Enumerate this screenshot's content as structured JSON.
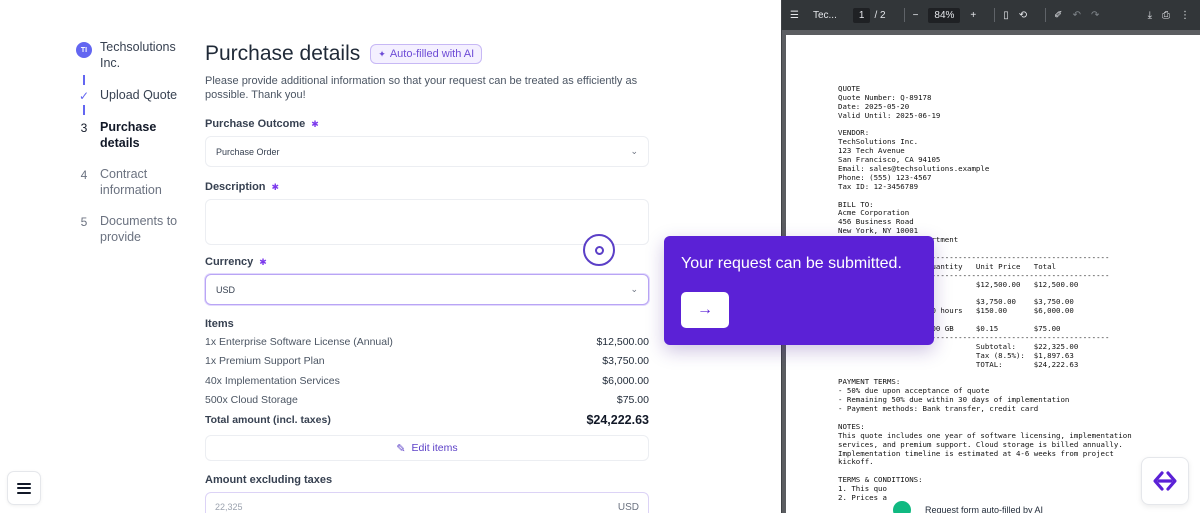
{
  "stepper": {
    "steps": [
      {
        "marker": "TI",
        "label": "Techsolutions Inc."
      },
      {
        "marker": "✓",
        "label": "Upload Quote"
      },
      {
        "marker": "3",
        "label": "Purchase details"
      },
      {
        "marker": "4",
        "label": "Contract information"
      },
      {
        "marker": "5",
        "label": "Documents to provide"
      }
    ]
  },
  "form": {
    "title": "Purchase details",
    "ai_badge": "Auto-filled with AI",
    "subtitle": "Please provide additional information so that your request can be treated as efficiently as possible. Thank you!",
    "purchase_outcome": {
      "label": "Purchase Outcome",
      "value": "Purchase Order"
    },
    "description": {
      "label": "Description",
      "value": ""
    },
    "currency": {
      "label": "Currency",
      "value": "USD"
    },
    "items": {
      "title": "Items",
      "rows": [
        {
          "name": "1x Enterprise Software License (Annual)",
          "amount": "$12,500.00"
        },
        {
          "name": "1x Premium Support Plan",
          "amount": "$3,750.00"
        },
        {
          "name": "40x Implementation Services",
          "amount": "$6,000.00"
        },
        {
          "name": "500x Cloud Storage",
          "amount": "$75.00"
        }
      ],
      "total_label": "Total amount (incl. taxes)",
      "total_value": "$24,222.63"
    },
    "edit_items_label": "Edit items",
    "amount_excl": {
      "label": "Amount excluding taxes",
      "value": "22,325",
      "unit": "USD"
    }
  },
  "pdf_viewer": {
    "filename": "Tec...",
    "page_current": "1",
    "page_total": "/ 2",
    "zoom": "84%",
    "lines": [
      "QUOTE",
      "Quote Number: Q-89178",
      "Date: 2025-05-20",
      "Valid Until: 2025-06-19",
      "",
      "VENDOR:",
      "TechSolutions Inc.",
      "123 Tech Avenue",
      "San Francisco, CA 94105",
      "Email: sales@techsolutions.example",
      "Phone: (555) 123-4567",
      "Tax ID: 12-3456789",
      "",
      "BILL TO:",
      "Acme Corporation",
      "456 Business Road",
      "New York, NY 10001",
      "                    artment",
      "",
      "-------------------------------------------------------------",
      "                    Quantity   Unit Price   Total",
      "-------------------------------------------------------------",
      "                    1          $12,500.00   $12,500.00",
      "",
      "                    1          $3,750.00    $3,750.00",
      "                    40 hours   $150.00      $6,000.00",
      "",
      "                    500 GB     $0.15        $75.00",
      "-------------------------------------------------------------",
      "                               Subtotal:    $22,325.00",
      "                               Tax (8.5%):  $1,897.63",
      "                               TOTAL:       $24,222.63",
      "",
      "PAYMENT TERMS:",
      "- 50% due upon acceptance of quote",
      "- Remaining 50% due within 30 days of implementation",
      "- Payment methods: Bank transfer, credit card",
      "",
      "NOTES:",
      "This quote includes one year of software licensing, implementation",
      "services, and premium support. Cloud storage is billed annually.",
      "Implementation timeline is estimated at 4-6 weeks from project",
      "kickoff.",
      "",
      "TERMS & CONDITIONS:",
      "1. This quo",
      "2. Prices a"
    ]
  },
  "popup": {
    "text": "Your request can be submitted.",
    "button_icon": "→"
  },
  "toast": {
    "text": "Request form auto-filled by AI"
  }
}
